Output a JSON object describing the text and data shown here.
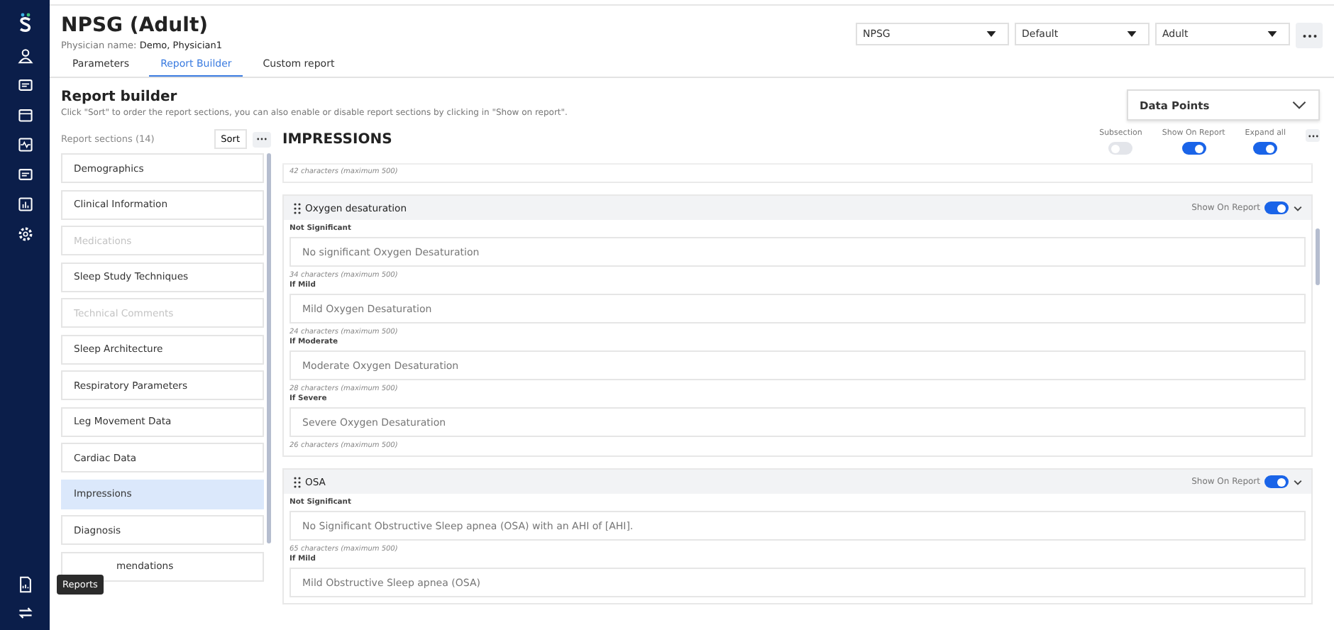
{
  "sidebar": {
    "tooltip": "Reports"
  },
  "header": {
    "title": "NPSG (Adult)",
    "physician_label": "Physician name:",
    "physician": "Demo, Physician1",
    "selects": [
      "NPSG",
      "Default",
      "Adult"
    ],
    "tabs": [
      {
        "label": "Parameters",
        "selected": false
      },
      {
        "label": "Report Builder",
        "selected": true
      },
      {
        "label": "Custom report",
        "selected": false
      }
    ]
  },
  "builder": {
    "title": "Report builder",
    "description": "Click \"Sort\" to order the report sections, you can also enable or disable report sections by clicking in \"Show on report\".",
    "data_points": "Data Points"
  },
  "sections_list": {
    "label": "Report sections (14)",
    "sort": "Sort",
    "items": [
      {
        "label": "Demographics",
        "disabled": false,
        "selected": false
      },
      {
        "label": "Clinical Information",
        "disabled": false,
        "selected": false
      },
      {
        "label": "Medications",
        "disabled": true,
        "selected": false
      },
      {
        "label": "Sleep Study Techniques",
        "disabled": false,
        "selected": false
      },
      {
        "label": "Technical Comments",
        "disabled": true,
        "selected": false
      },
      {
        "label": "Sleep Architecture",
        "disabled": false,
        "selected": false
      },
      {
        "label": "Respiratory Parameters",
        "disabled": false,
        "selected": false
      },
      {
        "label": "Leg Movement Data",
        "disabled": false,
        "selected": false
      },
      {
        "label": "Cardiac Data",
        "disabled": false,
        "selected": false
      },
      {
        "label": "Impressions",
        "disabled": false,
        "selected": true
      },
      {
        "label": "Diagnosis",
        "disabled": false,
        "selected": false
      },
      {
        "label": "mendations",
        "disabled": false,
        "selected": false
      }
    ]
  },
  "main": {
    "title": "IMPRESSIONS",
    "toggles": [
      {
        "label": "Subsection",
        "on": false
      },
      {
        "label": "Show On Report",
        "on": true
      },
      {
        "label": "Expand all",
        "on": true
      }
    ],
    "top_count": "42 characters (maximum 500)",
    "groups": [
      {
        "name": "Oxygen desaturation",
        "show_label": "Show On Report",
        "on": true,
        "fields": [
          {
            "label": "Not Significant",
            "value": "No significant Oxygen Desaturation",
            "count": "34 characters (maximum 500)"
          },
          {
            "label": "If Mild",
            "value": "Mild Oxygen Desaturation",
            "count": "24 characters (maximum 500)"
          },
          {
            "label": "If Moderate",
            "value": "Moderate Oxygen Desaturation",
            "count": "28 characters (maximum 500)"
          },
          {
            "label": "If Severe",
            "value": "Severe Oxygen Desaturation",
            "count": "26 characters (maximum 500)"
          }
        ]
      },
      {
        "name": "OSA",
        "show_label": "Show On Report",
        "on": true,
        "fields": [
          {
            "label": "Not Significant",
            "value": "No Significant Obstructive Sleep apnea (OSA) with an AHI of [AHI].",
            "count": "65 characters (maximum 500)"
          },
          {
            "label": "If Mild",
            "value": "Mild Obstructive Sleep apnea (OSA)"
          }
        ]
      }
    ]
  }
}
